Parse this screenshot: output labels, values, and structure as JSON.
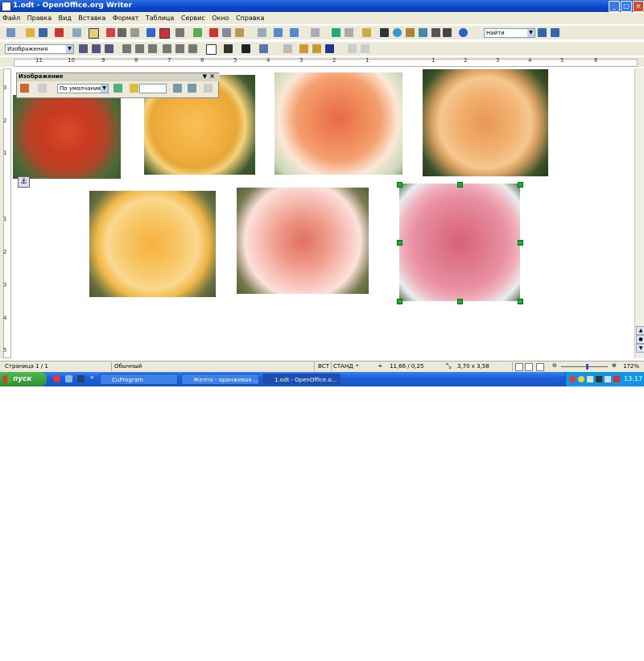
{
  "window": {
    "title": "1.odt - OpenOffice.org Writer"
  },
  "menu": [
    "Файл",
    "Правка",
    "Вид",
    "Вставка",
    "Формат",
    "Таблица",
    "Сервис",
    "Окно",
    "Справка"
  ],
  "toolbar": {
    "find_label": "Найти",
    "style_value": "Изображения"
  },
  "ruler": {
    "h_labels": [
      "11",
      "10",
      "9",
      "8",
      "7",
      "6",
      "5",
      "4",
      "3",
      "2",
      "1",
      "1",
      "2",
      "3",
      "4",
      "5",
      "6"
    ],
    "v_labels": [
      "3",
      "2",
      "1",
      "1",
      "2",
      "3",
      "4",
      "5"
    ]
  },
  "image_toolbar": {
    "title": "Изображение",
    "mode_value": "По умолчанию"
  },
  "status": {
    "page": "Страница 1 / 1",
    "style": "Обычный",
    "insert": "ВСТ",
    "select": "СТАНД",
    "position": "11,66 / 0,25",
    "size": "3,70 x 3,58",
    "zoom": "172%"
  },
  "taskbar": {
    "start": "пуск",
    "tasks": [
      "CuProgram",
      "Желто - оранжевая ...",
      "1.odt - OpenOffice.o..."
    ],
    "clock": "13:17"
  },
  "icons": [
    "document-icon",
    "anchor-icon",
    "close-icon",
    "minimize-icon",
    "maximize-icon",
    "help-icon",
    "search-icon"
  ]
}
